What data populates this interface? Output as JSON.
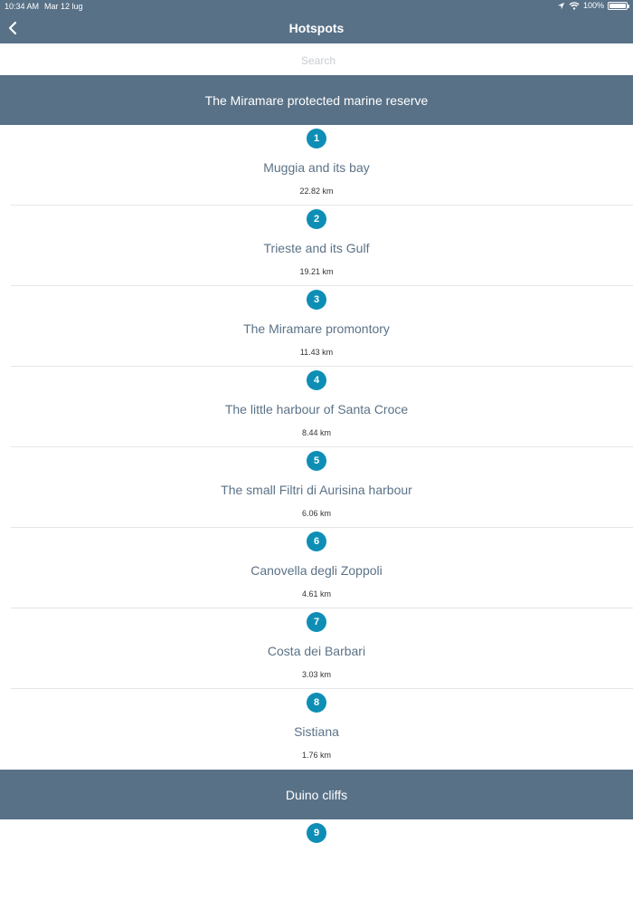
{
  "status_bar": {
    "time": "10:34 AM",
    "date": "Mar 12 lug",
    "battery": "100%",
    "battery_level": 1.0
  },
  "header": {
    "title": "Hotspots"
  },
  "search": {
    "placeholder": "Search"
  },
  "colors": {
    "header_bg": "#587187",
    "badge": "#0e8eb5",
    "title_text": "#5b7287"
  },
  "sections": [
    {
      "title": "The Miramare protected marine reserve",
      "items": [
        {
          "number": "1",
          "name": "Muggia and its bay",
          "distance": "22.82 km"
        },
        {
          "number": "2",
          "name": "Trieste and its Gulf",
          "distance": "19.21 km"
        },
        {
          "number": "3",
          "name": "The Miramare promontory",
          "distance": "11.43 km"
        },
        {
          "number": "4",
          "name": "The little harbour of Santa Croce",
          "distance": "8.44 km"
        },
        {
          "number": "5",
          "name": "The small Filtri di Aurisina harbour",
          "distance": "6.06 km"
        },
        {
          "number": "6",
          "name": "Canovella degli Zoppoli",
          "distance": "4.61 km"
        },
        {
          "number": "7",
          "name": "Costa dei Barbari",
          "distance": "3.03 km"
        },
        {
          "number": "8",
          "name": "Sistiana",
          "distance": "1.76 km"
        }
      ]
    },
    {
      "title": "Duino cliffs",
      "items": [
        {
          "number": "9",
          "name": "",
          "distance": ""
        }
      ]
    }
  ]
}
